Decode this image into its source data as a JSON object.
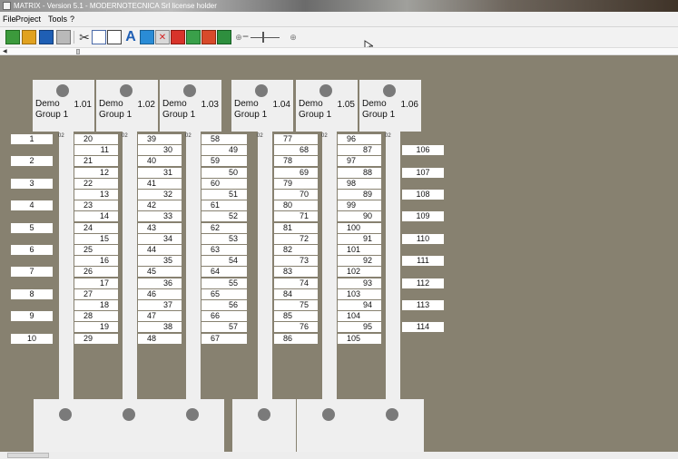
{
  "window": {
    "title": "MATRIX - Version 5.1 - MODERNOTECNICA Srl license holder"
  },
  "menu": {
    "file": "File",
    "project": "Project",
    "tools": "Tools",
    "help": "?"
  },
  "toolbar": {
    "buttons": [
      "new-icon",
      "open-icon",
      "save-icon",
      "print-icon",
      "cut-icon",
      "copy-icon",
      "paste-icon",
      "text-icon",
      "undo-icon",
      "cancel-icon",
      "fill-icon",
      "image-icon",
      "color-icon",
      "export-icon",
      "zoom-in-icon",
      "zoom-out-icon"
    ],
    "zoom_minus": "−"
  },
  "colors": {
    "workspace": "#878170",
    "card": "#efefef",
    "hole": "#7a7a7a",
    "cell": "#ffffff"
  },
  "cards": [
    {
      "name1": "Demo",
      "name2": "Group 1",
      "num": "1.01"
    },
    {
      "name1": "Demo",
      "name2": "Group 1",
      "num": "1.02"
    },
    {
      "name1": "Demo",
      "name2": "Group 1",
      "num": "1.03"
    },
    {
      "name1": "Demo",
      "name2": "Group 1",
      "num": "1.04"
    },
    {
      "name1": "Demo",
      "name2": "Group 1",
      "num": "1.05"
    },
    {
      "name1": "Demo",
      "name2": "Group 1",
      "num": "1.06"
    }
  ],
  "tag_label": "02",
  "columns": {
    "c0": [
      "1",
      "2",
      "3",
      "4",
      "5",
      "6",
      "7",
      "8",
      "9",
      "10"
    ],
    "c1": [
      "20",
      "11",
      "21",
      "12",
      "22",
      "13",
      "23",
      "14",
      "24",
      "15",
      "25",
      "16",
      "26",
      "17",
      "27",
      "18",
      "28",
      "19",
      "29"
    ],
    "c2": [
      "39",
      "30",
      "40",
      "31",
      "41",
      "32",
      "42",
      "33",
      "43",
      "34",
      "44",
      "35",
      "45",
      "36",
      "46",
      "37",
      "47",
      "38",
      "48"
    ],
    "c3": [
      "58",
      "49",
      "59",
      "50",
      "60",
      "51",
      "61",
      "52",
      "62",
      "53",
      "63",
      "54",
      "64",
      "55",
      "65",
      "56",
      "66",
      "57",
      "67"
    ],
    "c4": [
      "77",
      "68",
      "78",
      "69",
      "79",
      "70",
      "80",
      "71",
      "81",
      "72",
      "82",
      "73",
      "83",
      "74",
      "84",
      "75",
      "85",
      "76",
      "86"
    ],
    "c5": [
      "96",
      "87",
      "97",
      "88",
      "98",
      "89",
      "99",
      "90",
      "100",
      "91",
      "101",
      "92",
      "102",
      "93",
      "103",
      "94",
      "104",
      "95",
      "105"
    ],
    "c6": [
      "106",
      "107",
      "108",
      "109",
      "110",
      "111",
      "112",
      "113",
      "114"
    ]
  }
}
